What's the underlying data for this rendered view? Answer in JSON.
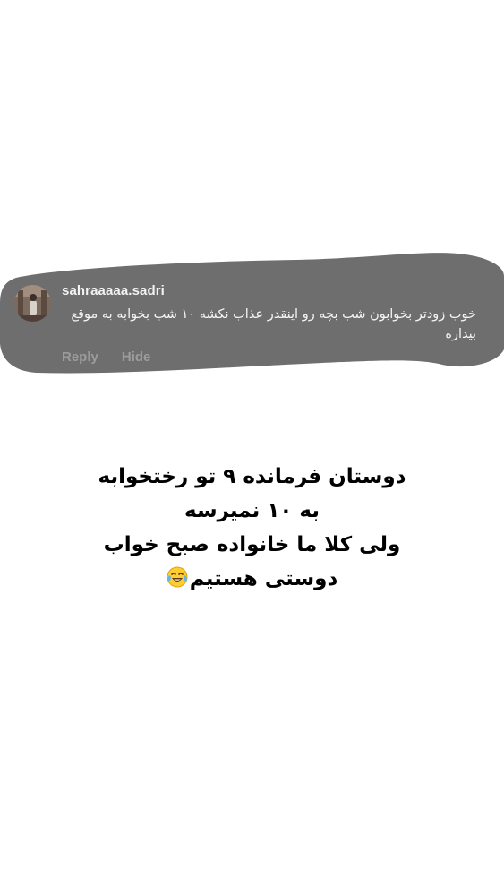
{
  "comment": {
    "username": "sahraaaaa.sadri",
    "text": "خوب زودتر بخوابون شب بچه رو اینقدر عذاب نکشه ۱۰ شب بخوابه به موقع بیداره",
    "reply_label": "Reply",
    "hide_label": "Hide",
    "bubble_color": "#6f6f6f",
    "avatar_icon": "avatar-photo"
  },
  "story": {
    "lines": [
      "دوستان فرمانده ۹ تو رختخوابه",
      "به ۱۰ نمیرسه",
      "ولی کلا ما خانواده صبح خواب",
      "دوستی هستیم"
    ],
    "emoji_icon": "face-with-tears-of-joy-icon"
  }
}
